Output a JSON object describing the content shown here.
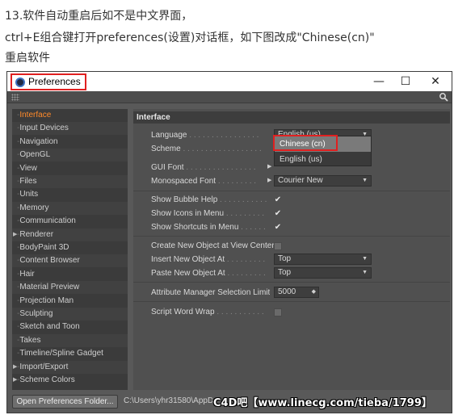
{
  "instructions": {
    "line1": "13.软件自动重启后如不是中文界面，",
    "line2": "ctrl+E组合键打开preferences(设置)对话框，如下图改成\"Chinese(cn)\"",
    "line3": "重启软件"
  },
  "window": {
    "title": "Preferences",
    "controls": {
      "minimize": "—",
      "maximize": "☐",
      "close": "✕"
    }
  },
  "sidebar": {
    "items": [
      {
        "label": "Interface",
        "selected": true,
        "expandable": false
      },
      {
        "label": "Input Devices",
        "selected": false,
        "expandable": false
      },
      {
        "label": "Navigation",
        "selected": false,
        "expandable": false
      },
      {
        "label": "OpenGL",
        "selected": false,
        "expandable": false
      },
      {
        "label": "View",
        "selected": false,
        "expandable": false
      },
      {
        "label": "Files",
        "selected": false,
        "expandable": false
      },
      {
        "label": "Units",
        "selected": false,
        "expandable": false
      },
      {
        "label": "Memory",
        "selected": false,
        "expandable": false
      },
      {
        "label": "Communication",
        "selected": false,
        "expandable": false
      },
      {
        "label": "Renderer",
        "selected": false,
        "expandable": true
      },
      {
        "label": "BodyPaint 3D",
        "selected": false,
        "expandable": false
      },
      {
        "label": "Content Browser",
        "selected": false,
        "expandable": false
      },
      {
        "label": "Hair",
        "selected": false,
        "expandable": false
      },
      {
        "label": "Material Preview",
        "selected": false,
        "expandable": false
      },
      {
        "label": "Projection Man",
        "selected": false,
        "expandable": false
      },
      {
        "label": "Sculpting",
        "selected": false,
        "expandable": false
      },
      {
        "label": "Sketch and Toon",
        "selected": false,
        "expandable": false
      },
      {
        "label": "Takes",
        "selected": false,
        "expandable": false
      },
      {
        "label": "Timeline/Spline Gadget",
        "selected": false,
        "expandable": false
      },
      {
        "label": "Import/Export",
        "selected": false,
        "expandable": true
      },
      {
        "label": "Scheme Colors",
        "selected": false,
        "expandable": true
      }
    ]
  },
  "panel": {
    "header": "Interface",
    "language": {
      "label": "Language",
      "value": "English (us)",
      "options": [
        "Chinese (cn)",
        "English (us)"
      ]
    },
    "scheme": {
      "label": "Scheme"
    },
    "gui_font": {
      "label": "GUI Font"
    },
    "mono_font": {
      "label": "Monospaced Font",
      "value": "Courier New"
    },
    "bubble_help": {
      "label": "Show Bubble Help",
      "checked": "✔"
    },
    "icons_menu": {
      "label": "Show Icons in Menu",
      "checked": "✔"
    },
    "shortcuts_menu": {
      "label": "Show Shortcuts in Menu",
      "checked": "✔"
    },
    "create_at_center": {
      "label": "Create New Object at View Center"
    },
    "insert_new": {
      "label": "Insert New Object At",
      "value": "Top"
    },
    "paste_new": {
      "label": "Paste New Object At",
      "value": "Top"
    },
    "attr_limit": {
      "label": "Attribute Manager Selection Limit",
      "value": "5000"
    },
    "word_wrap": {
      "label": "Script Word Wrap"
    }
  },
  "footer": {
    "open_folder_button": "Open Preferences Folder...",
    "path": "C:\\Users\\yhr31580\\AppD",
    "watermark": "C4D吧【www.linecg.com/tieba/1799】"
  },
  "colors": {
    "selected_item": "#ff8a2a",
    "highlight_box": "#e02020"
  }
}
